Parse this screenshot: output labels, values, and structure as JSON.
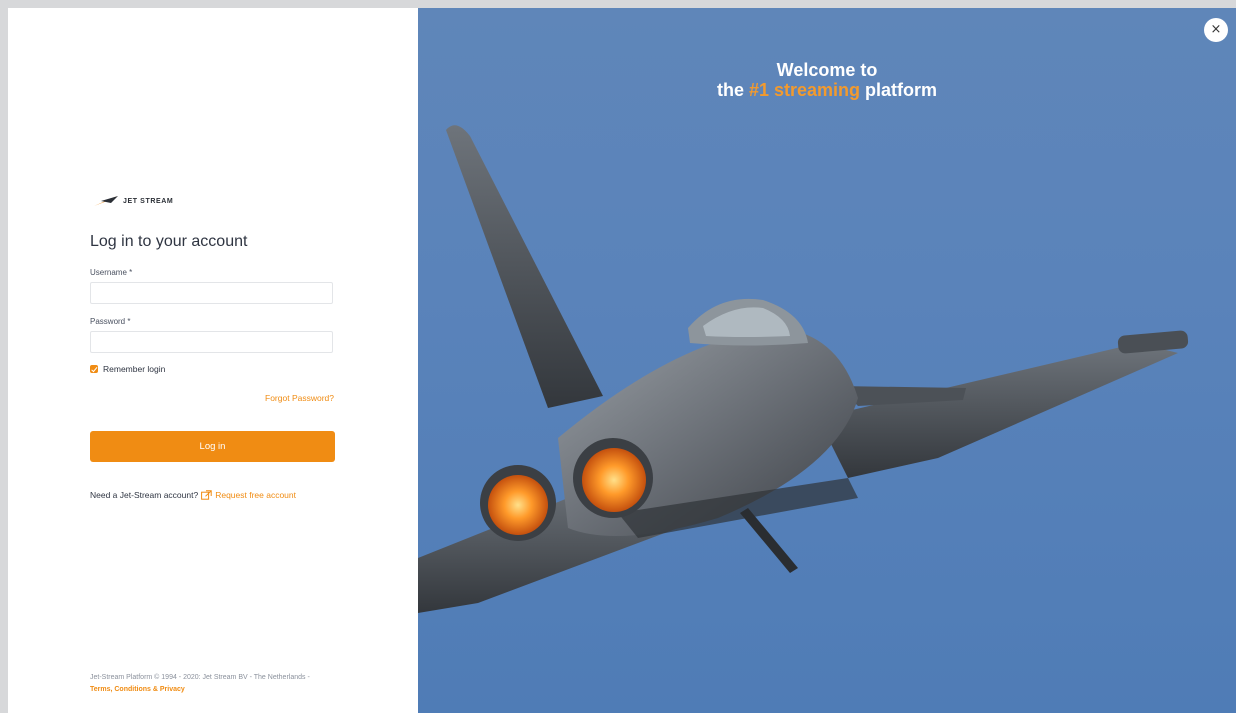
{
  "brand": {
    "wordmark": "JET STREAM"
  },
  "login": {
    "title": "Log in to your account",
    "username_label": "Username",
    "password_label": "Password",
    "required_mark": " *",
    "username_value": "",
    "password_value": "",
    "remember_label": "Remember login",
    "remember_checked": true,
    "forgot_label": "Forgot Password?",
    "submit_label": "Log in",
    "need_account_text": "Need a Jet-Stream account?",
    "request_label": "Request free account"
  },
  "footer": {
    "copyright": "Jet-Stream Platform © 1994 - 2020: Jet Stream BV - The Netherlands -",
    "terms_label": "Terms, Conditions & Privacy"
  },
  "hero": {
    "line1": "Welcome to",
    "line2_pre": "the ",
    "line2_accent": "#1 streaming",
    "line2_post": " platform"
  },
  "close_label": "×",
  "colors": {
    "accent": "#f08c13",
    "sky": "#5a83ba"
  }
}
